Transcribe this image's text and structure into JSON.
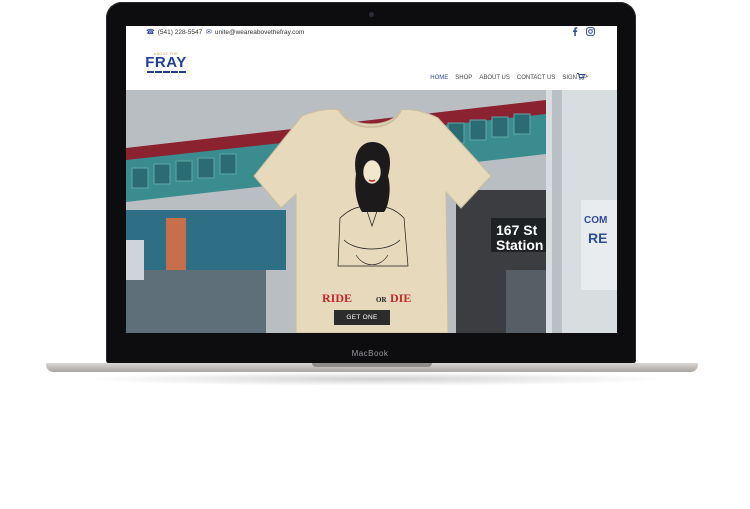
{
  "device": {
    "brand": "MacBook"
  },
  "topbar": {
    "phone": "(541) 228-5547",
    "email": "unite@weareabovethefray.com",
    "social": [
      "facebook-icon",
      "instagram-icon"
    ]
  },
  "header": {
    "logo": {
      "top": "ABOVE THE",
      "main": "FRAY"
    },
    "nav": [
      "HOME",
      "SHOP",
      "ABOUT US",
      "CONTACT US",
      "SIGN UP"
    ],
    "active": "HOME",
    "cart_icon": "cart-icon"
  },
  "hero": {
    "shirt_text": {
      "left": "RIDE",
      "mid": "OR",
      "right": "DIE"
    },
    "station_sign": "167 St Station",
    "poster_text": "COM RE",
    "cta": "GET ONE"
  },
  "colors": {
    "brand_blue": "#2f4b9a",
    "cta_bg": "#2c2c2c",
    "shirt": "#e9dcbf",
    "shirt_text_red": "#c8262a"
  }
}
